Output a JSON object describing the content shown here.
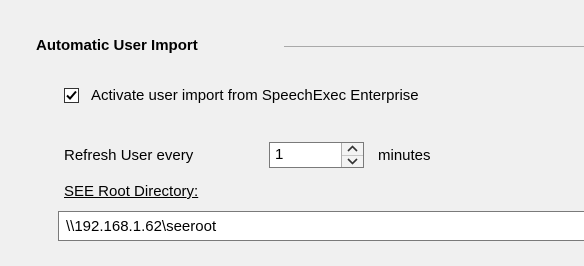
{
  "group": {
    "title": "Automatic User Import"
  },
  "activate_import": {
    "label": "Activate user import from SpeechExec Enterprise",
    "checked": true
  },
  "refresh": {
    "label": "Refresh User every",
    "value": "1",
    "unit_label": "minutes"
  },
  "see_root": {
    "label": "SEE Root Directory:",
    "value": "\\\\192.168.1.62\\seeroot"
  },
  "icons": {
    "checkmark": "checkmark-icon",
    "spin_up": "chevron-up-icon",
    "spin_down": "chevron-down-icon"
  },
  "colors": {
    "background": "#f0f0f0",
    "field_border": "#7a7a7a",
    "group_rule": "#a9a9a9"
  }
}
